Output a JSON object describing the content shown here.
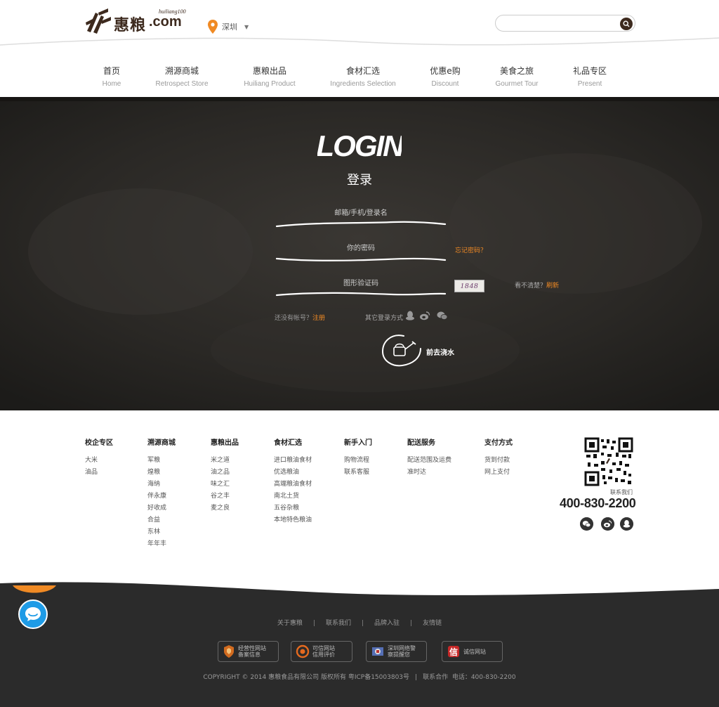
{
  "header": {
    "logo_cn": "惠粮",
    "logo_com": ".com",
    "logo_sub": "huiliang100",
    "city": "深圳",
    "search_placeholder": ""
  },
  "nav": [
    {
      "cn": "首页",
      "en": "Home"
    },
    {
      "cn": "溯源商城",
      "en": "Retrospect Store"
    },
    {
      "cn": "惠粮出品",
      "en": "Huiliang Product"
    },
    {
      "cn": "食材汇选",
      "en": "Ingredients Selection"
    },
    {
      "cn": "优惠e购",
      "en": "Discount"
    },
    {
      "cn": "美食之旅",
      "en": "Gourmet Tour"
    },
    {
      "cn": "礼品专区",
      "en": "Present"
    }
  ],
  "login": {
    "title": "LOGIN",
    "subtitle": "登录",
    "username_placeholder": "邮箱/手机/登录名",
    "password_placeholder": "你的密码",
    "captcha_placeholder": "图形验证码",
    "forgot": "忘记密码？",
    "captcha_text": "1848",
    "unclear_prefix": "看不清楚？",
    "refresh": "刷新",
    "no_account": "还没有帐号？",
    "register": "注册",
    "other_login": "其它登录方式",
    "submit": "前去浇水"
  },
  "footer": {
    "columns": [
      {
        "head": "校企专区",
        "links": [
          "大米",
          "油品"
        ]
      },
      {
        "head": "溯源商城",
        "links": [
          "军粮",
          "煌粮",
          "海纳",
          "伴永康",
          "好收成",
          "合益",
          "东林",
          "年年丰"
        ]
      },
      {
        "head": "惠粮出品",
        "links": [
          "米之道",
          "油之品",
          "味之汇",
          "谷之丰",
          "麦之良"
        ]
      },
      {
        "head": "食材汇选",
        "links": [
          "进口粮油食材",
          "优选粮油",
          "高端粮油食材",
          "南北土货",
          "五谷杂粮",
          "本地特色粮油"
        ]
      },
      {
        "head": "新手入门",
        "links": [
          "购物流程",
          "联系客服"
        ]
      },
      {
        "head": "配送服务",
        "links": [
          "配送范围及运费",
          "准时达"
        ]
      },
      {
        "head": "支付方式",
        "links": [
          "货到付款",
          "网上支付"
        ]
      }
    ],
    "contact_us": "联系我们",
    "hotline": "400-830-2200"
  },
  "bottom": {
    "links": [
      "关于惠粮",
      "联系我们",
      "品牌入驻",
      "友情链"
    ],
    "badges": [
      {
        "text": "经营性网站\n备案信息"
      },
      {
        "text": "可信网站\n信用评价"
      },
      {
        "text": "深圳网络警\n察提醒您"
      },
      {
        "text": "诚信网站"
      }
    ],
    "copyright": "COPYRIGHT © 2014 惠粮食品有限公司 版权所有 粤ICP备15003803号",
    "coop": "联系合作",
    "phone": "电话：400-830-2200"
  },
  "colors": {
    "brand_brown": "#3d2a1e",
    "accent_orange": "#f08a24",
    "board_bg": "#2c2a27",
    "footer_dark": "#2b2b2b",
    "chat_blue": "#1e9be6"
  }
}
